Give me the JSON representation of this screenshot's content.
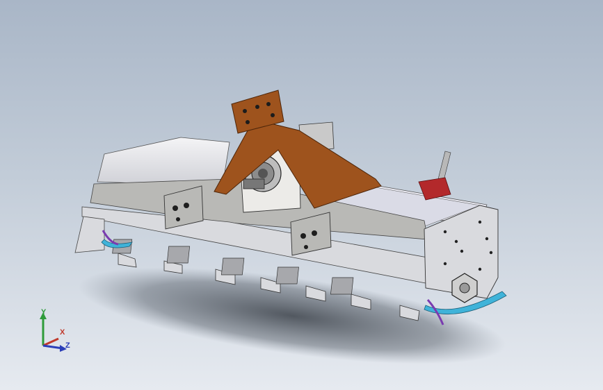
{
  "viewport": {
    "background_top": "#a9b6c7",
    "background_bottom": "#e6eaf0"
  },
  "model": {
    "body_color": "#d9dade",
    "frame_color": "#b9b9b6",
    "housing_color": "#ecebe8",
    "mast_color": "#9e531d",
    "skid_color": "#3fb3d9",
    "clip_color": "#7a3bb0",
    "valve_color": "#b3292b"
  },
  "triad": {
    "y_label": "Y",
    "x_label": "X",
    "z_label": "Z",
    "y_color": "#2e9b3a",
    "x_color": "#c0392b",
    "z_color": "#2b3fb8"
  }
}
